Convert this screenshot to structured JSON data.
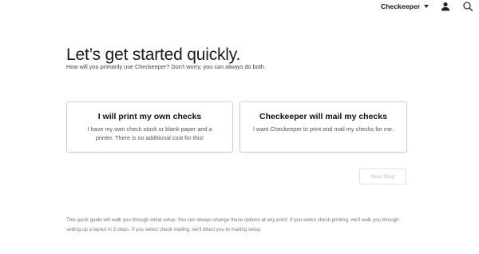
{
  "header": {
    "account_name": "Checkeeper",
    "icons": [
      "chevron-down-icon",
      "user-icon",
      "search-icon"
    ]
  },
  "main": {
    "title": "Let’s get started quickly.",
    "subtitle": "How will you primarily use Checkeeper? Don't worry, you can always do both.",
    "options": [
      {
        "title": "I will print my own checks",
        "description": "I have my own check stock or blank paper and a printer. There is no additional cost for this!"
      },
      {
        "title": "Checkeeper will mail my checks",
        "description": "I want Checkeeper to print and mail my checks for me."
      }
    ],
    "next_label": "Next Step"
  },
  "footer": {
    "note": "This quick guide will walk you through initial setup. You can always change these options at any point. If you select check printing, we'll walk you through setting up a layout in 3 steps. If you select check mailing, we'll direct you to mailing setup."
  }
}
